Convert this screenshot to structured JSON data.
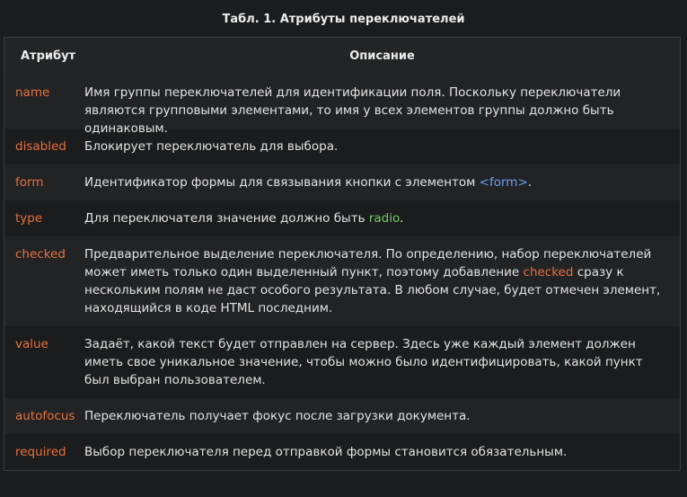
{
  "caption": "Табл. 1. Атрибуты переключателей",
  "headers": {
    "attr": "Атрибут",
    "desc": "Описание"
  },
  "rows": [
    {
      "attr": "name",
      "desc": "Имя группы переключателей для идентификации поля. Поскольку переключатели являются групповыми элементами, то имя у всех элементов группы должно быть одинаковым."
    },
    {
      "attr": "disabled",
      "desc": "Блокирует переключатель для выбора."
    },
    {
      "attr": "form",
      "desc_before": "Идентификатор формы для связывания кнопки с элементом ",
      "desc_code": "<form>",
      "desc_after": "."
    },
    {
      "attr": "type",
      "desc_before": "Для переключателя значение должно быть ",
      "desc_code": "radio",
      "desc_after": "."
    },
    {
      "attr": "checked",
      "desc_before": "Предварительное выделение переключателя. По определению, набор переключателей может иметь только один выделенный пункт, поэтому добавление ",
      "desc_code": "checked",
      "desc_after": " сразу к нескольким полям не даст особого результата. В любом случае, будет отмечен элемент, находящийся в коде HTML последним."
    },
    {
      "attr": "value",
      "desc": "Задаёт, какой текст будет отправлен на сервер. Здесь уже каждый элемент должен иметь свое уникальное значение, чтобы можно было идентифицировать, какой пункт был выбран пользователем."
    },
    {
      "attr": "autofocus",
      "desc": "Переключатель получает фокус после загрузки документа."
    },
    {
      "attr": "required",
      "desc": "Выбор переключателя перед отправкой формы становится обязательным."
    }
  ],
  "colors": {
    "background": "#1b1c1d",
    "row_alt": "#222325",
    "attribute": "#e8713f",
    "tag_code": "#6aa2f0",
    "value_code": "#6fcf63"
  }
}
